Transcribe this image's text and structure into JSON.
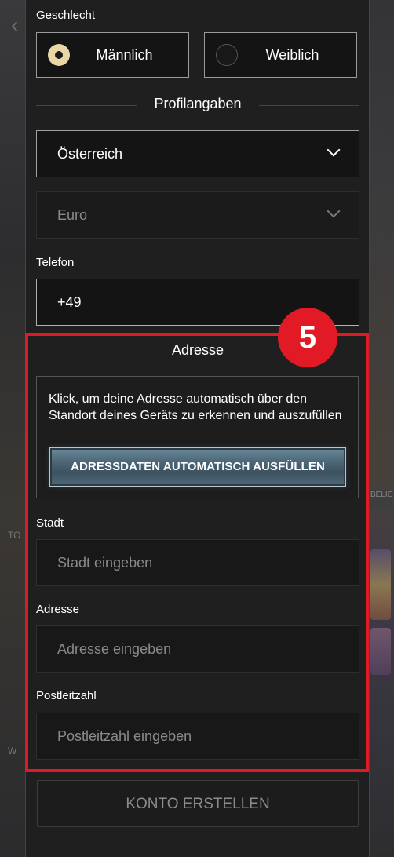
{
  "gender": {
    "label": "Geschlecht",
    "options": [
      "Männlich",
      "Weiblich"
    ],
    "selected": "Männlich"
  },
  "profile": {
    "heading": "Profilangaben",
    "country": "Österreich",
    "currency": "Euro",
    "phone_label": "Telefon",
    "phone_value": "+49"
  },
  "address": {
    "step_badge": "5",
    "heading": "Adresse",
    "autofill_description": "Klick, um deine Adresse automatisch über den Standort deines Geräts zu erkennen und auszufüllen",
    "autofill_button": "ADRESSDATEN AUTOMATISCH AUSFÜLLEN",
    "city_label": "Stadt",
    "city_placeholder": "Stadt eingeben",
    "street_label": "Adresse",
    "street_placeholder": "Adresse eingeben",
    "zip_label": "Postleitzahl",
    "zip_placeholder": "Postleitzahl eingeben"
  },
  "submit_label": "KONTO ERSTELLEN",
  "background": {
    "right_snippet": "BELIE",
    "left_snippet_1": "TO",
    "left_snippet_2": "W"
  },
  "colors": {
    "highlight_red": "#e01a25",
    "radio_selected": "#e9d7a6",
    "panel_bg": "#1f1f1f"
  }
}
